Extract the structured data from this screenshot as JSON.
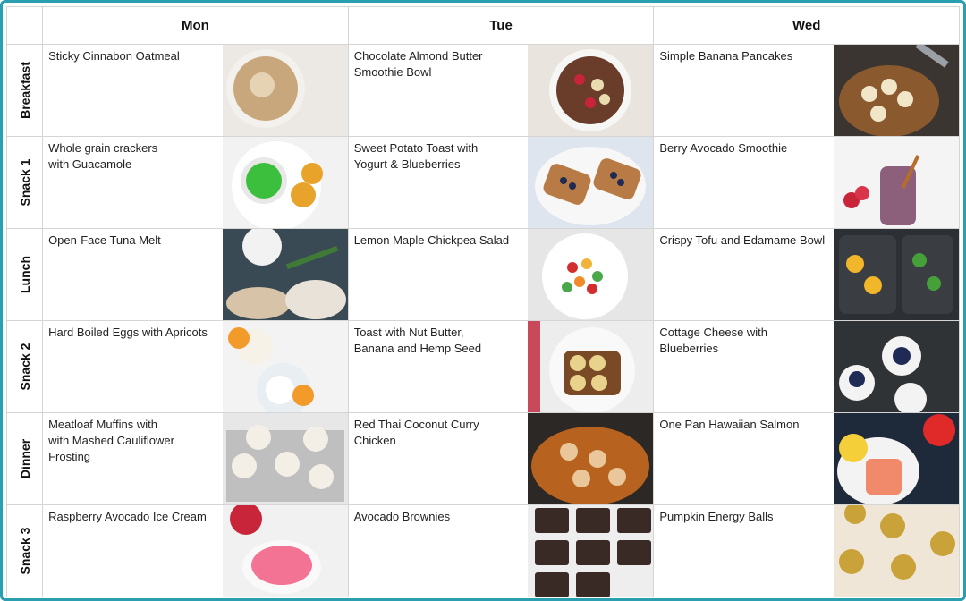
{
  "days": [
    "Mon",
    "Tue",
    "Wed"
  ],
  "meals": [
    "Breakfast",
    "Snack 1",
    "Lunch",
    "Snack 2",
    "Dinner",
    "Snack 3"
  ],
  "rows": [
    {
      "mon": {
        "lines": [
          "Sticky Cinnabon Oatmeal"
        ]
      },
      "tue": {
        "lines": [
          "Chocolate Almond Butter",
          "Smoothie Bowl"
        ]
      },
      "wed": {
        "lines": [
          "Simple Banana Pancakes"
        ]
      }
    },
    {
      "mon": {
        "lines": [
          "Whole grain crackers",
          "with Guacamole"
        ]
      },
      "tue": {
        "lines": [
          "Sweet Potato Toast with",
          "Yogurt & Blueberries"
        ]
      },
      "wed": {
        "lines": [
          "Berry Avocado Smoothie"
        ]
      }
    },
    {
      "mon": {
        "lines": [
          "Open-Face Tuna Melt"
        ]
      },
      "tue": {
        "lines": [
          "Lemon Maple Chickpea Salad"
        ]
      },
      "wed": {
        "lines": [
          "Crispy Tofu and Edamame Bowl"
        ]
      }
    },
    {
      "mon": {
        "lines": [
          "Hard Boiled Eggs with Apricots"
        ]
      },
      "tue": {
        "lines": [
          "Toast with Nut Butter,",
          "Banana and Hemp Seed"
        ]
      },
      "wed": {
        "lines": [
          "Cottage Cheese with",
          "Blueberries"
        ]
      }
    },
    {
      "mon": {
        "lines": [
          "Meatloaf Muffins with",
          "with Mashed Cauliflower",
          "Frosting"
        ]
      },
      "tue": {
        "lines": [
          "Red Thai Coconut Curry Chicken"
        ]
      },
      "wed": {
        "lines": [
          "One Pan Hawaiian Salmon"
        ]
      }
    },
    {
      "mon": {
        "lines": [
          "Raspberry Avocado Ice Cream"
        ]
      },
      "tue": {
        "lines": [
          "Avocado Brownies"
        ]
      },
      "wed": {
        "lines": [
          "Pumpkin Energy Balls"
        ]
      }
    }
  ],
  "colors": {
    "frame_border": "#2a9fb0",
    "grid_line": "#d5d5d5"
  }
}
